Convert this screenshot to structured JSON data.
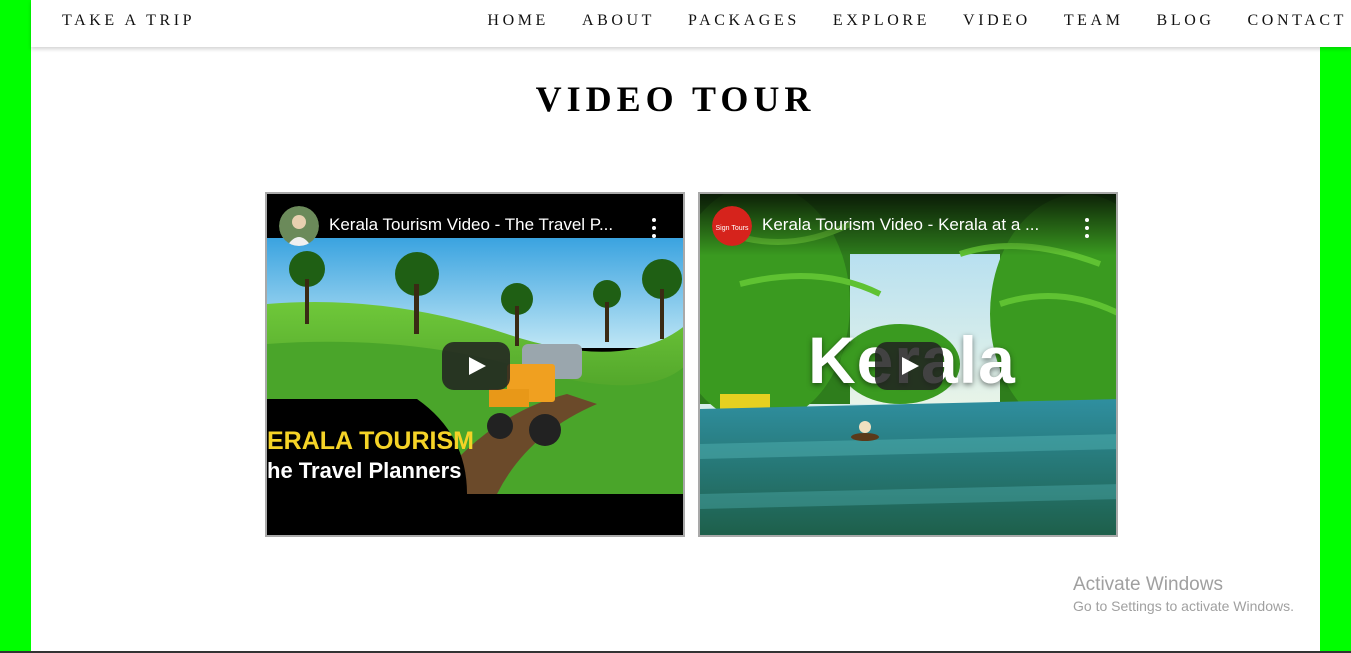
{
  "brand": "TAKE A TRIP",
  "nav": [
    "HOME",
    "ABOUT",
    "PACKAGES",
    "EXPLORE",
    "VIDEO",
    "TEAM",
    "BLOG",
    "CONTACT"
  ],
  "section_title": "VIDEO TOUR",
  "videos": [
    {
      "title": "Kerala Tourism Video - The Travel P...",
      "overlay_line1": "ERALA TOURISM",
      "overlay_line2": "he Travel Planners"
    },
    {
      "title": "Kerala Tourism Video - Kerala at a ...",
      "overlay_text": "Kerala",
      "channel_logo": "Sign Tours"
    }
  ],
  "watermark": {
    "line1": "Activate Windows",
    "line2": "Go to Settings to activate Windows."
  },
  "colors": {
    "side_bars": "#00ff00",
    "page": "#ffffff",
    "overlay_yellow": "#f5d327"
  }
}
